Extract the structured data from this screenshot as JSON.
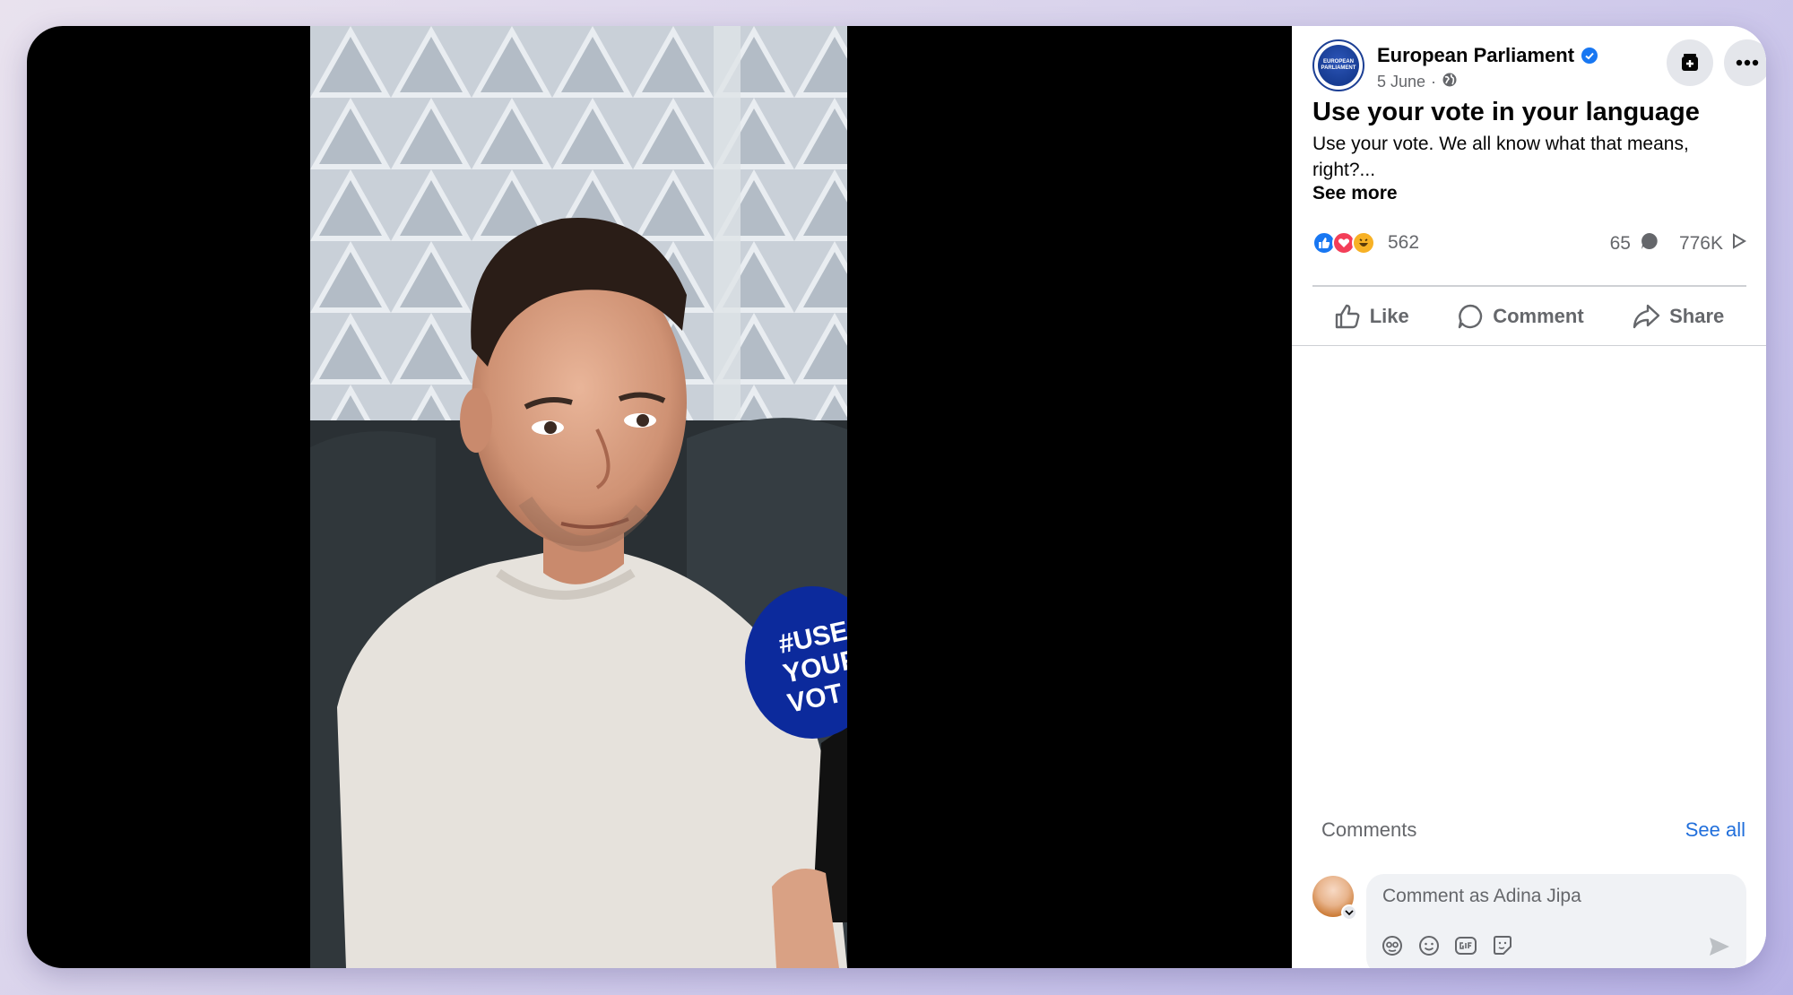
{
  "post": {
    "page_name": "European Parliament",
    "avatar_text": "EUROPEAN PARLIAMENT",
    "date": "5 June",
    "separator": "·",
    "title": "Use your vote in your language",
    "body": "Use your vote. We all know what that means, right?...",
    "see_more": "See more"
  },
  "video": {
    "mic_text_line1": "#USE",
    "mic_text_line2": "YOUR",
    "mic_text_line3": "VOT"
  },
  "stats": {
    "reactions_count": "562",
    "comments_count": "65",
    "views_count": "776K",
    "reaction_colors": {
      "like": "#1877f2",
      "love": "#f33e58",
      "haha": "#f7b125"
    }
  },
  "actions": {
    "like": "Like",
    "comment": "Comment",
    "share": "Share"
  },
  "comments": {
    "label": "Comments",
    "see_all": "See all",
    "placeholder": "Comment as Adina Jipa"
  },
  "colors": {
    "accent": "#1877f2",
    "link": "#216fdb",
    "secondary_text": "#65676b",
    "mic_blue": "#0c2a9c"
  }
}
